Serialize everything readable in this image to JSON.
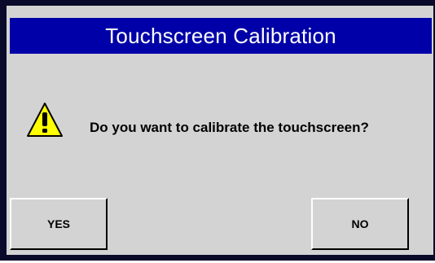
{
  "dialog": {
    "title": "Touchscreen Calibration",
    "message": "Do you want to calibrate the touchscreen?",
    "icon": "warning-icon",
    "buttons": {
      "yes_label": "YES",
      "no_label": "NO"
    }
  },
  "colors": {
    "title_bar": "#0000a8",
    "title_text": "#ffffff",
    "dialog_background": "#d3d3d3",
    "warning_fill": "#ffff00"
  }
}
